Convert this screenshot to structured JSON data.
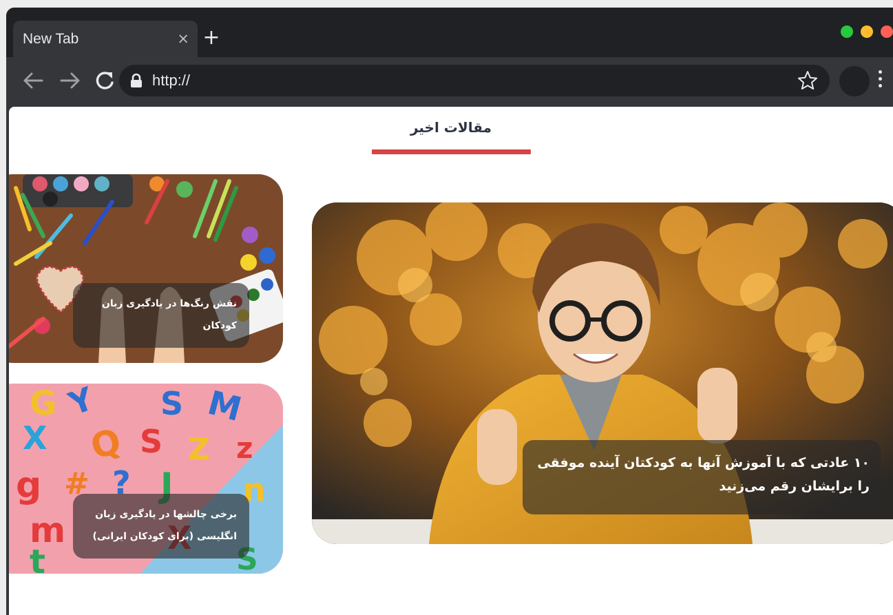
{
  "browser": {
    "tab_title": "New Tab",
    "tab_close_glyph": "×",
    "new_tab_glyph": "+",
    "url": "http://",
    "back_glyph": "←",
    "forward_glyph": "→",
    "reload_glyph": "C",
    "window_controls": {
      "colors": [
        "#27c93f",
        "#ffbd2e",
        "#ff5f56"
      ]
    },
    "icons": [
      "back-arrow-icon",
      "forward-arrow-icon",
      "reload-icon",
      "lock-icon",
      "star-icon",
      "kebab-menu-icon"
    ]
  },
  "page": {
    "section_title": "مقالات اخیر",
    "accent_color": "#d64545"
  },
  "articles": [
    {
      "title": "۱۰ عادتی که با آموزش آنها به کودکتان آینده موفقی را برایشان رقم می‌زنید",
      "image": "smiling-boy-with-glasses-thumbs-up"
    },
    {
      "title": "نقش رنگ‌ها در یادگیری زبان کودکان",
      "image": "paint-palette-and-pencils"
    },
    {
      "title": "برخی چالشها در یادگیری زبان انگلیسی (برای کودکان ایرانی)",
      "image": "colorful-plastic-letters"
    }
  ]
}
